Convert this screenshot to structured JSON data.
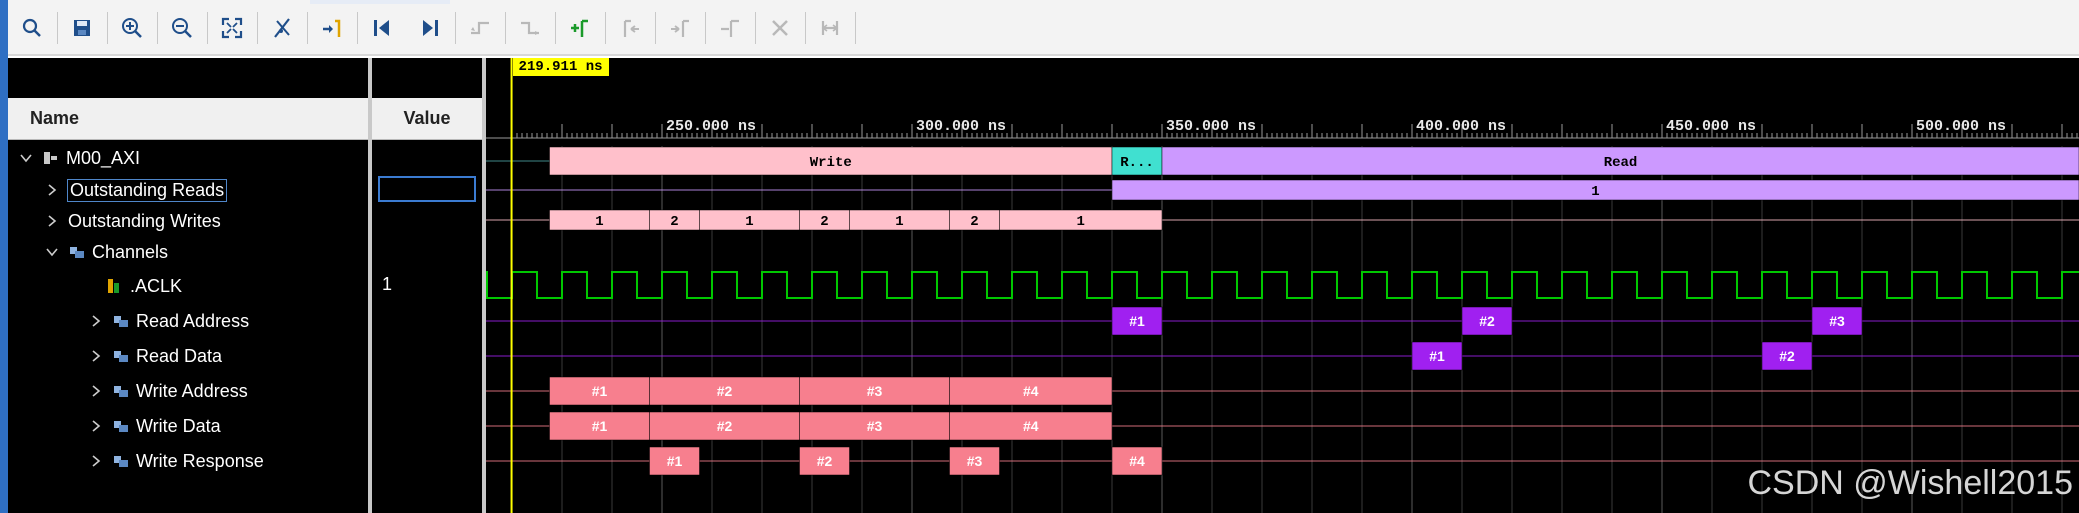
{
  "toolbar": {
    "buttons": [
      {
        "name": "search-icon",
        "enabled": true
      },
      {
        "name": "save-icon",
        "enabled": true
      },
      {
        "name": "zoom-in-icon",
        "enabled": true
      },
      {
        "name": "zoom-out-icon",
        "enabled": true
      },
      {
        "name": "zoom-fit-icon",
        "enabled": true
      },
      {
        "name": "cursor-to-zero-icon",
        "enabled": true
      },
      {
        "name": "go-to-cursor-icon",
        "enabled": true
      },
      {
        "name": "go-to-start-icon",
        "enabled": true
      },
      {
        "name": "go-to-end-icon",
        "enabled": true
      },
      {
        "name": "previous-transition-icon",
        "enabled": false
      },
      {
        "name": "next-transition-icon",
        "enabled": false
      },
      {
        "name": "add-marker-icon",
        "enabled": true
      },
      {
        "name": "previous-marker-icon",
        "enabled": false
      },
      {
        "name": "next-marker-icon",
        "enabled": false
      },
      {
        "name": "swap-cursors-icon",
        "enabled": false
      },
      {
        "name": "delete-marker-icon",
        "enabled": false
      },
      {
        "name": "snap-to-transition-icon",
        "enabled": false
      }
    ]
  },
  "columns": {
    "name": "Name",
    "value": "Value"
  },
  "tree": {
    "root": "M00_AXI",
    "outstanding_reads": "Outstanding Reads",
    "outstanding_writes": "Outstanding Writes",
    "channels": "Channels",
    "aclk": ".ACLK",
    "aclk_value": "1",
    "read_address": "Read Address",
    "read_data": "Read Data",
    "write_address": "Write Address",
    "write_data": "Write Data",
    "write_response": "Write Response"
  },
  "waveform": {
    "cursor_time": "219.911 ns",
    "time_ticks": [
      "250.000 ns",
      "300.000 ns",
      "350.000 ns",
      "400.000 ns",
      "450.000 ns",
      "500.000 ns"
    ],
    "tick_values_ns": [
      250,
      300,
      350,
      400,
      450,
      500
    ],
    "cursor_ns": 219.911,
    "top_state": {
      "write_label": "Write",
      "read_short_label": "R...",
      "read_label": "Read"
    },
    "outstanding_reads_bar": "1",
    "outstanding_writes_bars": [
      "1",
      "2",
      "1",
      "2",
      "1",
      "2",
      "1"
    ],
    "read_address_txns": [
      "#1",
      "#2",
      "#3"
    ],
    "read_data_txns": [
      "#1",
      "#2"
    ],
    "write_address_txns": [
      "#1",
      "#2",
      "#3",
      "#4"
    ],
    "write_data_txns": [
      "#1",
      "#2",
      "#3",
      "#4"
    ],
    "write_response_txns": [
      "#1",
      "#2",
      "#3",
      "#4"
    ]
  },
  "colors": {
    "write_pink": "#ffc0cb",
    "txn_pink": "#f77f8e",
    "read_purple": "#cc99ff",
    "txn_purple": "#a020f0",
    "clk_green": "#00c800",
    "teal": "#40e0d0",
    "cursor_yellow": "#ffff00"
  },
  "watermark": "CSDN @Wishell2015"
}
